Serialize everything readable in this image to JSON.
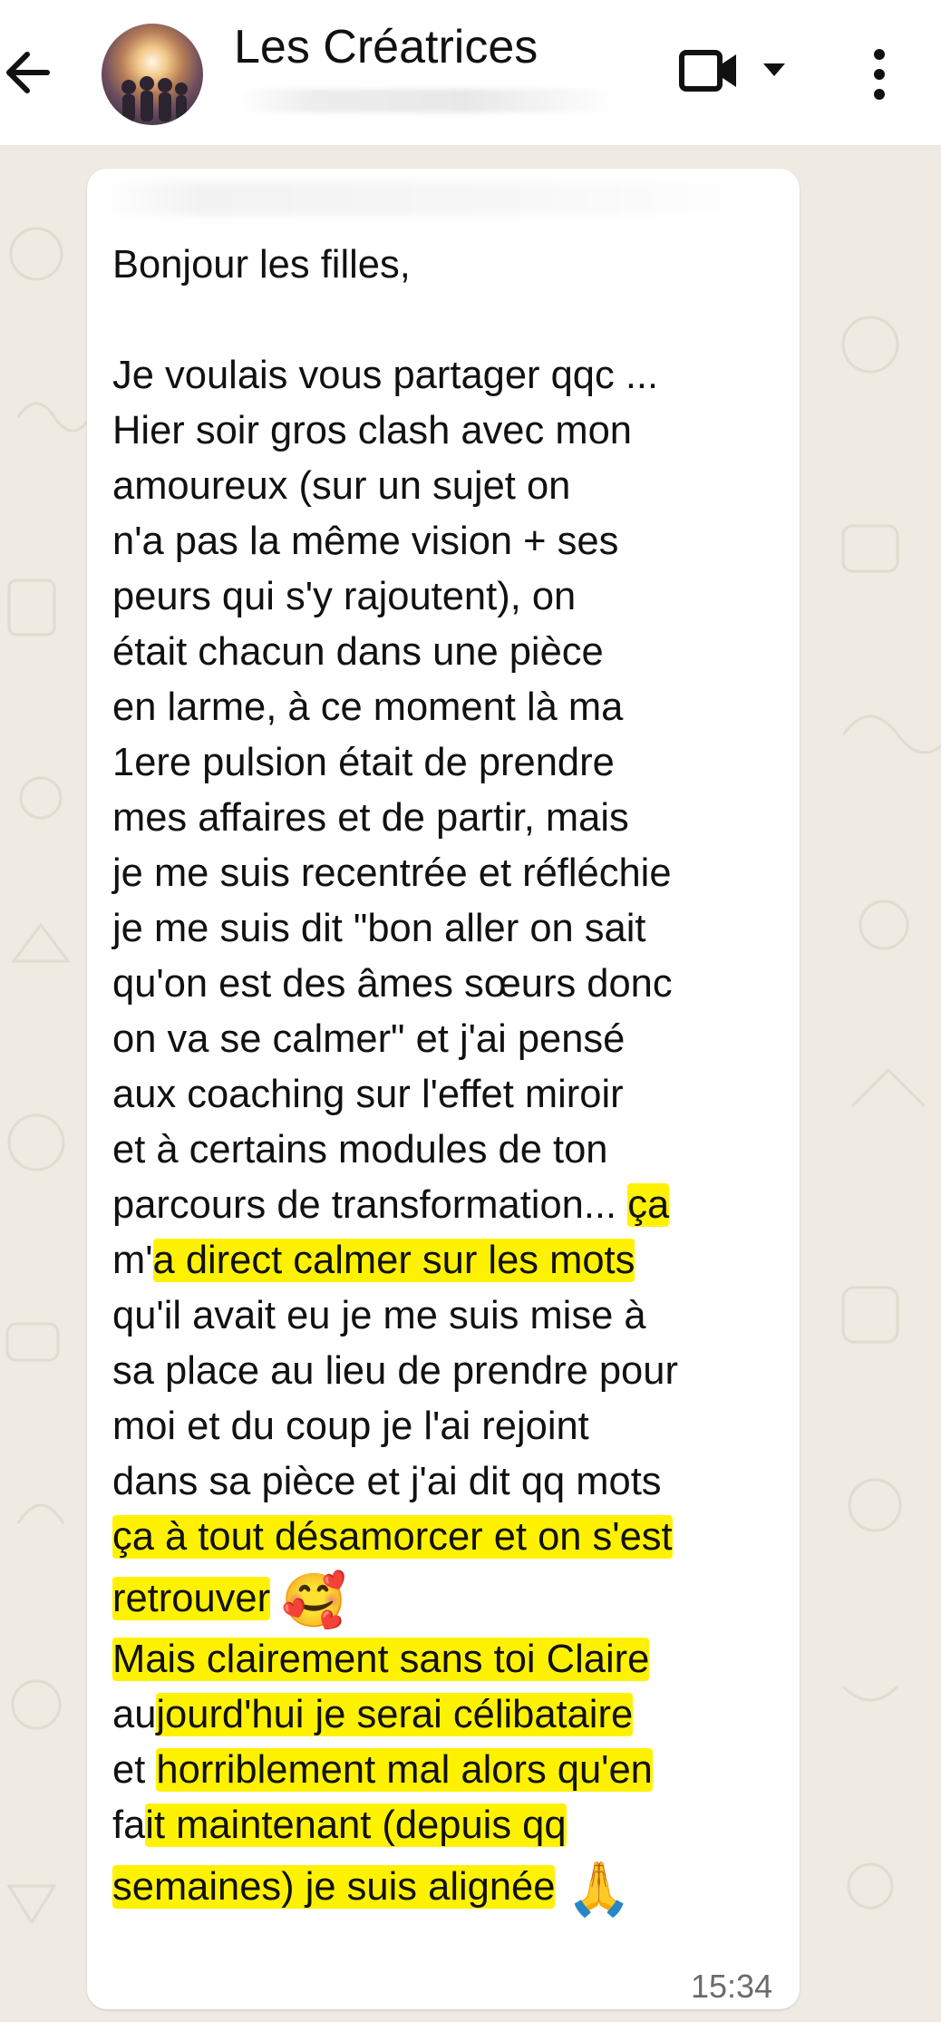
{
  "header": {
    "title": "Les Créatrices",
    "icons": [
      "back-arrow-icon",
      "group-avatar",
      "video-call-icon",
      "chevron-down-icon",
      "more-vertical-icon"
    ]
  },
  "message": {
    "lines": [
      "Bonjour les filles,",
      "",
      "Je voulais vous partager qqc ...",
      "Hier soir gros clash avec mon",
      "amoureux (sur un sujet on",
      "n'a pas la même vision + ses",
      "peurs qui s'y rajoutent), on",
      "était chacun dans une pièce",
      "en larme, à ce moment là ma",
      "1ere pulsion était de prendre",
      "mes affaires et de partir, mais",
      "je me suis recentrée et réfléchie",
      "je me suis dit \"bon aller on sait",
      "qu'on est des âmes sœurs donc",
      "on va se calmer\" et j'ai pensé",
      "aux coaching sur l'effet miroir",
      "et à certains modules de ton",
      "parcours de transformation... ",
      "ça",
      "m'",
      "a direct calmer sur les mots",
      "qu'il avait eu je me suis mise à",
      "sa place au lieu de prendre pour",
      "moi et du coup je l'ai rejoint",
      "dans sa pièce et j'ai dit qq mots",
      "ça à tout désamorcer et on s'est",
      "retrouver",
      "Mais clairement sans toi Claire",
      "au",
      "jourd'hui je serai célibataire",
      "et ",
      "horriblement mal alors qu'en",
      "fa",
      "it maintenant (depuis qq",
      "semaines) je suis alignée"
    ],
    "emoji_1": "🥰",
    "emoji_2": "🙏",
    "time": "15:34"
  },
  "colors": {
    "wallpaper": "#efeae2",
    "bubble": "#ffffff",
    "highlight": "#fff200",
    "text": "#111111"
  }
}
